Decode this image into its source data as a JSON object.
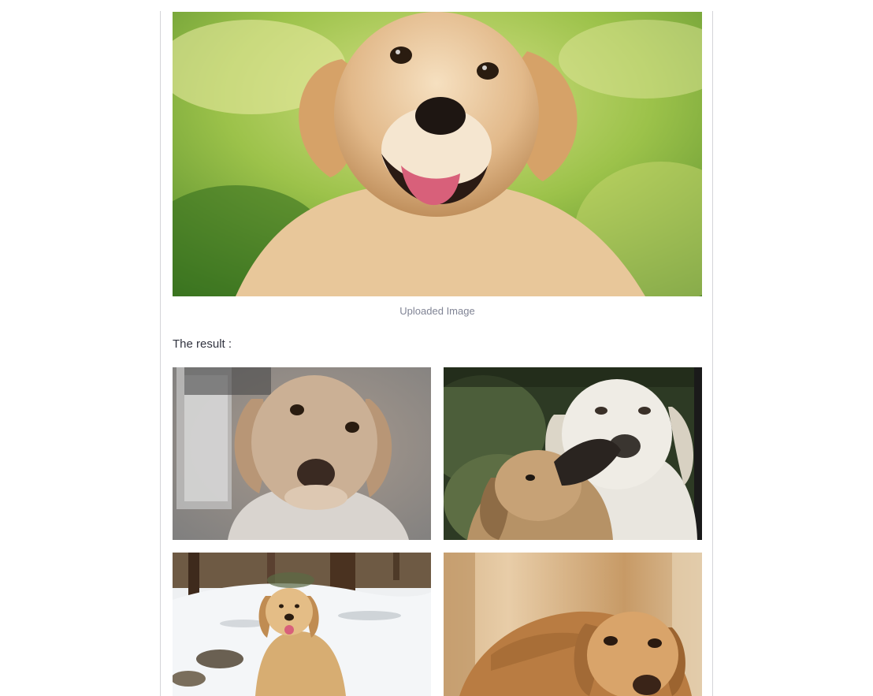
{
  "uploaded": {
    "caption": "Uploaded Image",
    "alt": "golden retriever portrait on grass"
  },
  "result": {
    "label": "The result :",
    "images": [
      {
        "alt": "sepia golden retriever close-up"
      },
      {
        "alt": "two dogs nuzzling"
      },
      {
        "alt": "golden retriever sitting in snowy forest"
      },
      {
        "alt": "golden retriever lying down"
      }
    ]
  }
}
